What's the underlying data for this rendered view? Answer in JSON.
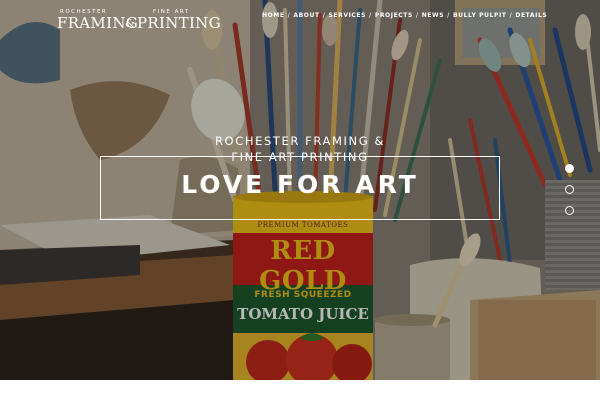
{
  "brand": {
    "line1_small": "ROCHESTER",
    "line1_big": "FRAMING",
    "ampersand": "&",
    "line2_small": "FINE ART",
    "line2_big": "PRINTING"
  },
  "nav": {
    "items": [
      "HOME",
      "ABOUT",
      "SERVICES",
      "PROJECTS",
      "NEWS",
      "BULLY PULPIT",
      "DETAILS"
    ],
    "separator": "/"
  },
  "hero": {
    "kicker_line1": "ROCHESTER FRAMING &",
    "kicker_line2": "FINE ART PRINTING",
    "title": "LOVE FOR ART",
    "can": {
      "top_label": "PREMIUM TOMATOES",
      "brand": "RED GOLD",
      "band_line1": "FRESH SQUEEZED",
      "band_line2": "TOMATO JUICE"
    }
  },
  "slider": {
    "count": 3,
    "active_index": 0
  },
  "colors": {
    "accent_white": "#ffffff",
    "can_red": "#c8221c",
    "can_yellow": "#f2c418",
    "can_green": "#1f5a2e"
  }
}
